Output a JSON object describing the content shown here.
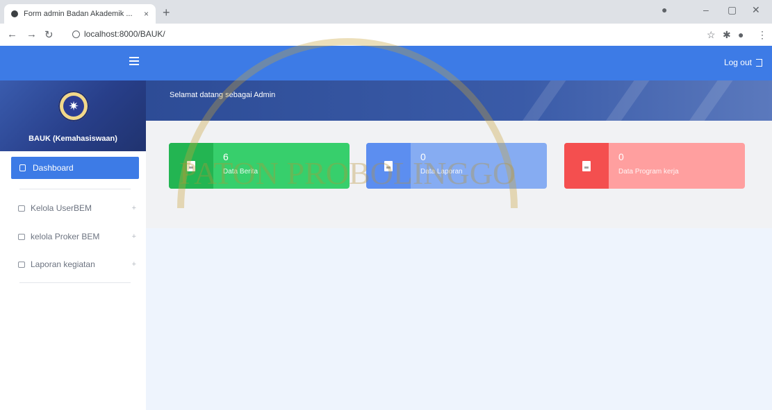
{
  "browser": {
    "tab_title": "Form admin Badan Akademik ...",
    "url": "localhost:8000/BAUK/",
    "new_tab": "+",
    "tab_close": "×"
  },
  "header": {
    "logout_label": "Log out"
  },
  "sidebar": {
    "org_title": "BAUK (Kemahasiswaan)",
    "active_item": "Dashboard",
    "items": [
      {
        "label": "Kelola UserBEM",
        "expand": "+"
      },
      {
        "label": "kelola Proker BEM",
        "expand": "+"
      },
      {
        "label": "Laporan kegiatan",
        "expand": "+"
      }
    ]
  },
  "main": {
    "welcome": "Selamat datang sebagai Admin",
    "cards": [
      {
        "value": "6",
        "label": "Data Berita",
        "color": "#37cf6c",
        "icon_bg": "#23b552"
      },
      {
        "value": "0",
        "label": "Data Laporan",
        "color": "#86acf2",
        "icon_bg": "#5c8ef0"
      },
      {
        "value": "0",
        "label": "Data Program kerja",
        "color": "#ff9f9f",
        "icon_bg": "#f44f4f"
      }
    ]
  },
  "watermark": {
    "text": "PATON PROBOLINGGO"
  },
  "colors": {
    "primary": "#3d7be6",
    "sidebar_header": "#283f8a"
  }
}
